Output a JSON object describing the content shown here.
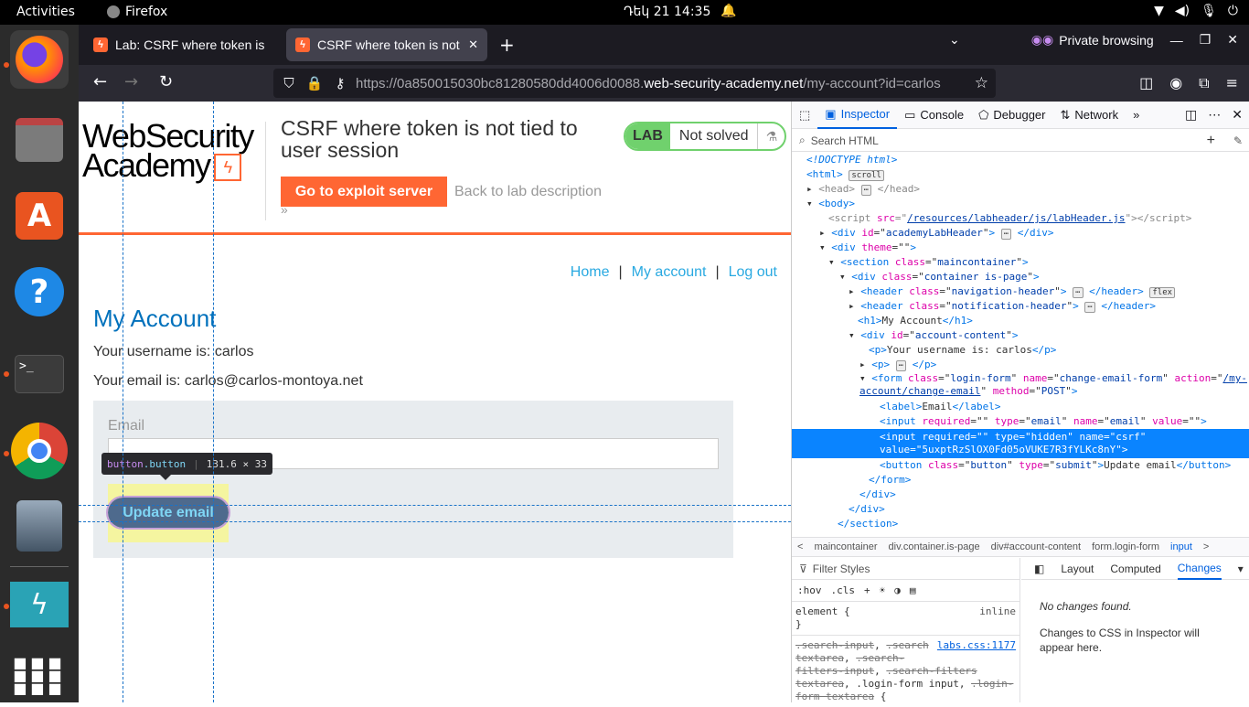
{
  "os": {
    "activities": "Activities",
    "app_name": "Firefox",
    "clock": "Դեկ 21  14:35"
  },
  "browser": {
    "tabs": [
      {
        "label": "Lab: CSRF where token is"
      },
      {
        "label": "CSRF where token is not"
      }
    ],
    "private_label": "Private browsing",
    "url_prefix": "https://0a850015030bc81280580dd4006d0088.",
    "url_host": "web-security-academy.net",
    "url_path": "/my-account?id=carlos"
  },
  "page": {
    "logo_line1": "WebSecurity",
    "logo_line2": "Academy",
    "lab_title": "CSRF where token is not tied to user session",
    "exploit_button": "Go to exploit server",
    "back_link": "Back to lab description",
    "lab_badge": "LAB",
    "lab_status": "Not solved",
    "nav": {
      "home": "Home",
      "sep": "|",
      "account": "My account",
      "logout": "Log out"
    },
    "heading": "My Account",
    "username_line": "Your username is: carlos",
    "email_line": "Your email is: carlos@carlos-montoya.net",
    "form": {
      "label": "Email",
      "button": "Update email"
    },
    "tooltip": {
      "tag": "button",
      "cls": ".button",
      "size": "131.6 × 33"
    }
  },
  "devtools": {
    "tabs": {
      "inspector": "Inspector",
      "console": "Console",
      "debugger": "Debugger",
      "network": "Network"
    },
    "search_placeholder": "Search HTML",
    "breadcrumbs": [
      "maincontainer",
      "div.container.is-page",
      "div#account-content",
      "form.login-form",
      "input"
    ],
    "filter_placeholder": "Filter Styles",
    "style_tools": [
      ":hov",
      ".cls"
    ],
    "element_rule": "element {",
    "element_inline": "inline",
    "rule_source": "labs.css:1177",
    "side_tabs": {
      "layout": "Layout",
      "computed": "Computed",
      "changes": "Changes"
    },
    "no_changes": "No changes found.",
    "changes_help": "Changes to CSS in Inspector will appear here."
  },
  "colors": {
    "accent": "#ff6633",
    "link": "#29a9e1",
    "heading": "#0071bc",
    "selected": "#0a84ff"
  }
}
